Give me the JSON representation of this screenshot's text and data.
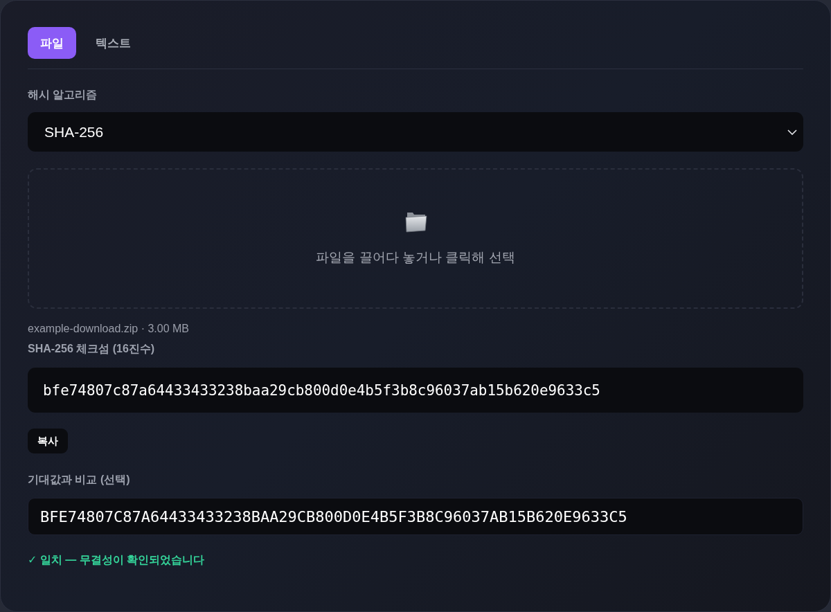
{
  "tabs": [
    {
      "label": "파일",
      "selected": true
    },
    {
      "label": "텍스트",
      "selected": false
    }
  ],
  "algorithm": {
    "label": "해시 알고리즘",
    "value": "SHA-256"
  },
  "dropzone": {
    "text": "파일을 끌어다 놓거나 클릭해 선택"
  },
  "file_info": "example-download.zip · 3.00 MB",
  "checksum": {
    "label": "SHA-256 체크섬 (16진수)",
    "value": "bfe74807c87a64433433238baa29cb800d0e4b5f3b8c96037ab15b620e9633c5",
    "copy_button": "복사"
  },
  "compare": {
    "label": "기대값과 비교 (선택)",
    "value": "BFE74807C87A64433433238BAA29CB800D0E4B5F3B8C96037AB15B620E9633C5"
  },
  "result": {
    "kind": "match",
    "text": "✓ 일치 — 무결성이 확인되었습니다"
  }
}
